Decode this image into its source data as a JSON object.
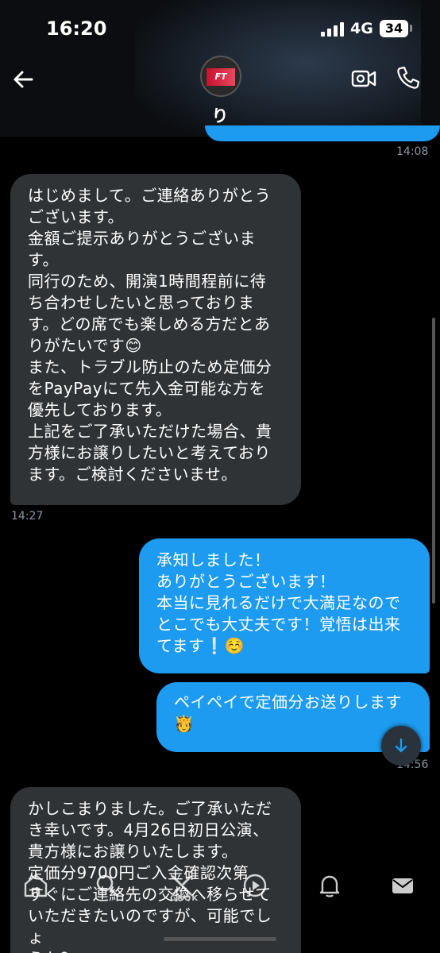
{
  "status_bar": {
    "time": "16:20",
    "network": "4G",
    "battery": "34"
  },
  "header": {
    "avatar_text": "FT",
    "contact_name": "り"
  },
  "messages": [
    {
      "direction": "out",
      "time": "14:08"
    },
    {
      "direction": "in",
      "text": "はじめまして。ご連絡ありがとう\nございます。\n金額ご提示ありがとうございま\nす。\n同行のため、開演1時間程前に待\nち合わせしたいと思っておりま\nす。どの席でも楽しめる方だとあ\nりがたいです😊\nまた、トラブル防止のため定価分\nをPayPayにて先入金可能な方を\n優先しております。\n上記をご了承いただけた場合、貴\n方様にお譲りしたいと考えており\nます。ご検討くださいませ。",
      "time": "14:27"
    },
    {
      "direction": "out",
      "text": "承知しました！\nありがとうございます！\n本当に見れるだけで大満足なので\nとこでも大丈夫です！覚悟は出来\nてます❕☺️"
    },
    {
      "direction": "out",
      "text": "ペイペイで定価分お送りします\n🫅",
      "time": "14:56"
    },
    {
      "direction": "in",
      "text": "かしこまりました。ご了承いただ\nき幸いです。4月26日初日公演、\n貴方様にお譲りいたします。\n定価分9700円ご入金確認次第\nすぐにご連絡先の交換へ移らせて\nいただきたいのですが、可能でしょ\nうか？"
    }
  ],
  "bottom_nav": {
    "grok_label": "GROK",
    "items": [
      "home-icon",
      "search-icon",
      "grok-icon",
      "video-icon",
      "bell-icon",
      "mail-icon"
    ]
  },
  "colors": {
    "outgoing_bubble": "#1d9bf0",
    "incoming_bubble": "#2f3336",
    "background": "#000000",
    "timestamp": "#8b98a5"
  }
}
